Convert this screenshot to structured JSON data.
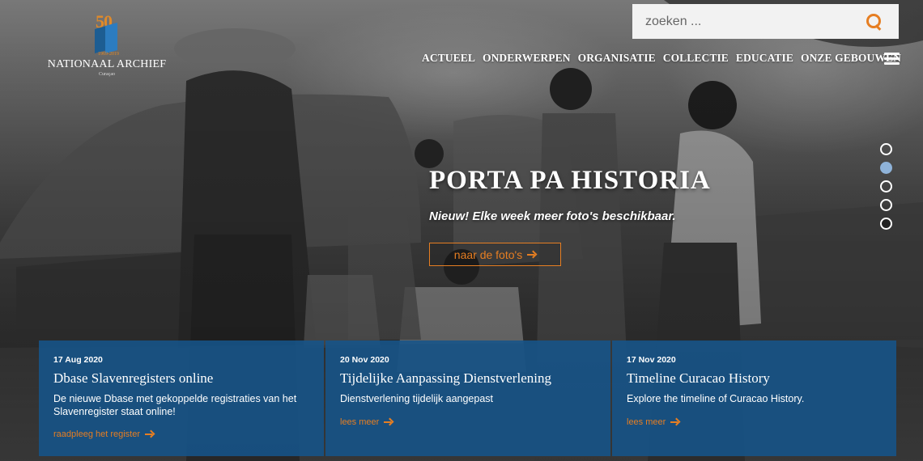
{
  "logo": {
    "anniversary_number": "50",
    "years": "1969-2019",
    "name": "NATIONAAL ARCHIEF",
    "location": "Curaçao",
    "accent_color": "#e08a2a",
    "block_colors": [
      "#1d5d92",
      "#2c7cc0"
    ]
  },
  "search": {
    "placeholder": "zoeken ...",
    "icon": "search-icon",
    "icon_color": "#e67e22"
  },
  "nav": {
    "items": [
      "ACTUEEL",
      "ONDERWERPEN",
      "ORGANISATIE",
      "COLLECTIE",
      "EDUCATIE",
      "ONZE GEBOUWEN"
    ],
    "menu_icon": "hamburger-menu-icon"
  },
  "slider": {
    "dot_count": 5,
    "active_index": 1
  },
  "hero": {
    "title": "PORTA PA HISTORIA",
    "subtitle": "Nieuw! Elke week meer foto's beschikbaar.",
    "button_label": "naar de foto's",
    "button_color": "#e67e22"
  },
  "news": {
    "card_color": "#16548a",
    "link_color": "#e67e22",
    "cards": [
      {
        "date": "17 Aug 2020",
        "title": "Dbase Slavenregisters online",
        "text": "De nieuwe Dbase met gekoppelde registraties van het Slavenregister staat online!",
        "link": "raadpleeg het register"
      },
      {
        "date": "20 Nov 2020",
        "title": "Tijdelijke Aanpassing Dienstverlening",
        "text": "Dienstverlening tijdelijk aangepast",
        "link": "lees meer"
      },
      {
        "date": "17 Nov 2020",
        "title": "Timeline Curacao History",
        "text": "Explore the timeline of Curacao History.",
        "link": "lees meer"
      }
    ]
  }
}
